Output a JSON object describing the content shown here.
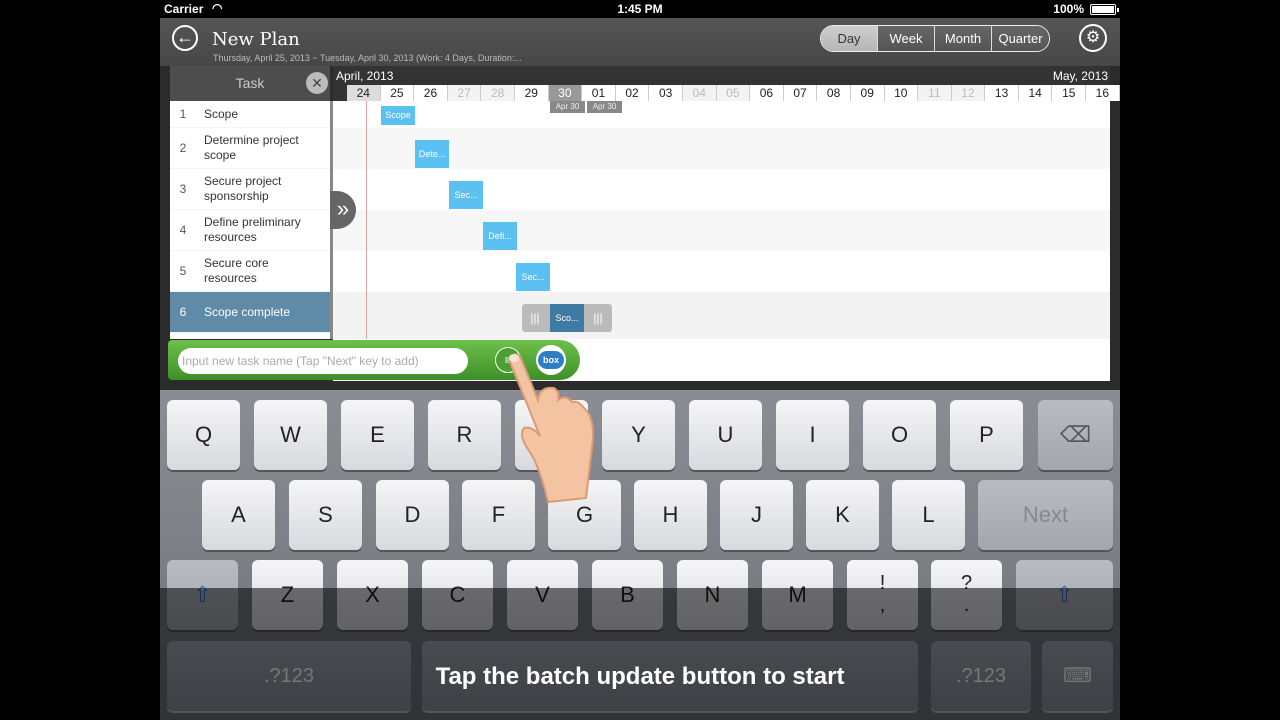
{
  "status_bar": {
    "carrier": "Carrier",
    "time": "1:45 PM",
    "battery": "100%"
  },
  "header": {
    "back_icon": "back-arrow-icon",
    "title": "New Plan",
    "subtitle": "Thursday, April 25, 2013 ~ Tuesday, April 30, 2013 (Work: 4 Days, Duration:...",
    "view_tabs": [
      "Day",
      "Week",
      "Month",
      "Quarter"
    ],
    "active_tab": "Day",
    "settings_icon": "gear-icon"
  },
  "task_panel": {
    "header": "Task",
    "close_icon": "close-icon",
    "expand_icon": "double-chevron-right-icon",
    "tasks": [
      {
        "num": "1",
        "name": "Scope"
      },
      {
        "num": "2",
        "name": "Determine project scope"
      },
      {
        "num": "3",
        "name": "Secure project sponsorship"
      },
      {
        "num": "4",
        "name": "Define preliminary resources"
      },
      {
        "num": "5",
        "name": "Secure core resources"
      },
      {
        "num": "6",
        "name": "Scope complete"
      }
    ],
    "selected_index": 5
  },
  "timeline": {
    "left_month": "April, 2013",
    "right_month": "May, 2013",
    "days": [
      "24",
      "25",
      "26",
      "27",
      "28",
      "29",
      "30",
      "01",
      "02",
      "03",
      "04",
      "05",
      "06",
      "07",
      "08",
      "09",
      "10",
      "11",
      "12",
      "13",
      "14",
      "15",
      "16"
    ],
    "weekend_days": [
      "27",
      "28",
      "04",
      "05",
      "11",
      "12"
    ],
    "highlight_day": "30",
    "date_tags": [
      "Apr 30",
      "Apr 30"
    ]
  },
  "gantt_bars": [
    "Scope",
    "Dete...",
    "Sec...",
    "Defi...",
    "Sec...",
    "Sco..."
  ],
  "input_bar": {
    "placeholder": "Input new task name (Tap \"Next\" key to add)",
    "batch_icon": "batch-update-icon",
    "box_label": "box"
  },
  "keyboard": {
    "row1": [
      "Q",
      "W",
      "E",
      "R",
      "T",
      "Y",
      "U",
      "I",
      "O",
      "P"
    ],
    "row2": [
      "A",
      "S",
      "D",
      "F",
      "G",
      "H",
      "J",
      "K",
      "L"
    ],
    "next": "Next",
    "row3": [
      "Z",
      "X",
      "C",
      "V",
      "B",
      "N",
      "M"
    ],
    "punct1": [
      "!",
      ","
    ],
    "punct2": [
      "?",
      "."
    ],
    "numbers_left": ".?123",
    "numbers_right": ".?123",
    "backspace_icon": "backspace-icon",
    "shift_icon": "shift-icon",
    "hide_keyboard_icon": "keyboard-hide-icon"
  },
  "caption": "Tap the batch update button to start"
}
